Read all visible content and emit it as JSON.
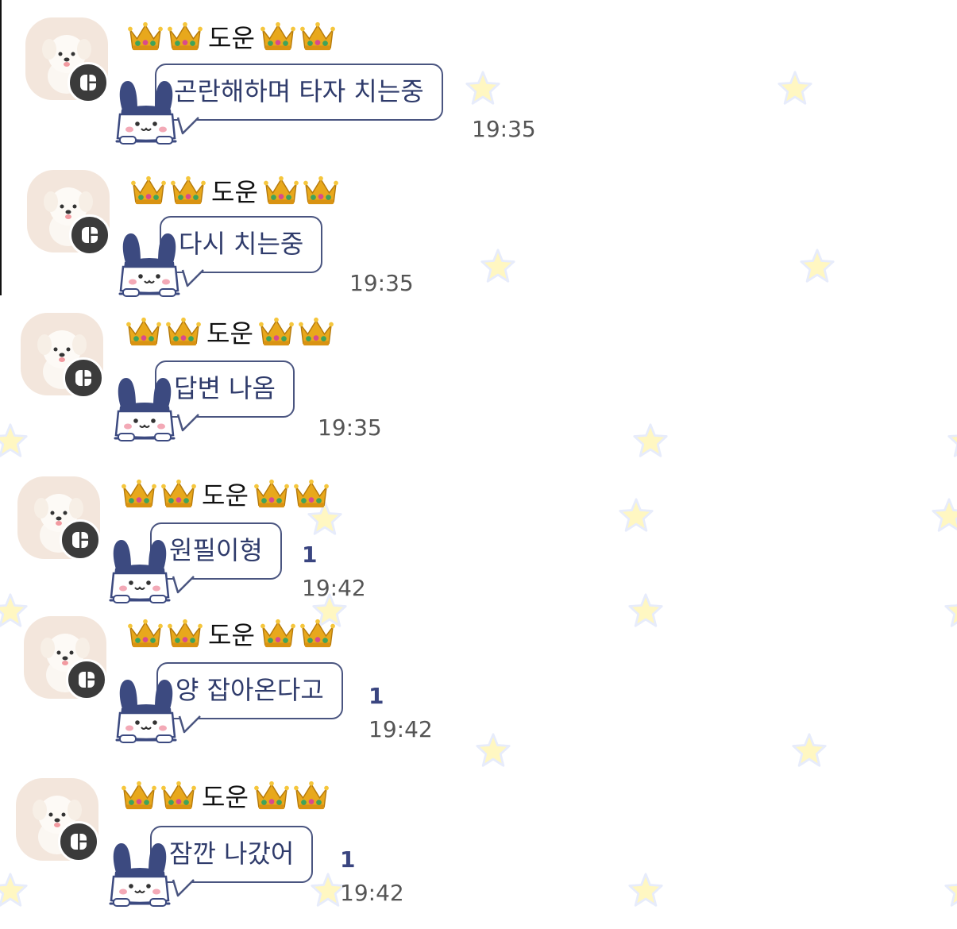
{
  "chat": {
    "sender_name": "도운",
    "messages": [
      {
        "text": "곤란해하며 타자 치는중",
        "time": "19:35",
        "unread": ""
      },
      {
        "text": "다시 치는중",
        "time": "19:35",
        "unread": ""
      },
      {
        "text": "답변 나옴",
        "time": "19:35",
        "unread": ""
      },
      {
        "text": "원필이형",
        "time": "19:42",
        "unread": "1"
      },
      {
        "text": "양 잡아온다고",
        "time": "19:42",
        "unread": "1"
      },
      {
        "text": "잠깐 나갔어",
        "time": "19:42",
        "unread": "1"
      }
    ]
  },
  "icons": {
    "avatar": "puppy-avatar",
    "badge": "chat-badge-icon",
    "name_decoration": "crown-icon",
    "bubble_mascot": "bunny-mascot-icon",
    "background_pattern": "star-icon"
  },
  "colors": {
    "bubble_border": "#4a5580",
    "bubble_text": "#2f3b6b",
    "unread": "#3a4580",
    "star": "#fff6bf"
  }
}
